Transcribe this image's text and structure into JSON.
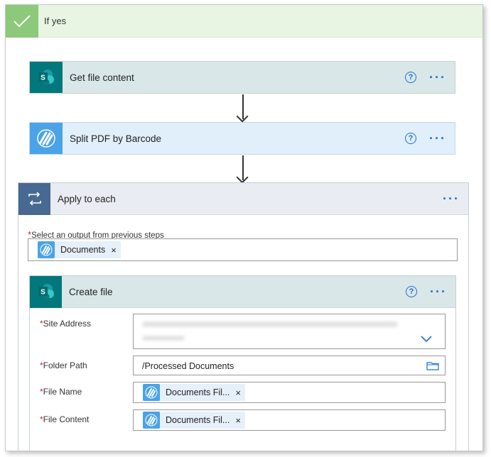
{
  "if_yes": {
    "title": "If yes"
  },
  "steps": {
    "get_file_content": {
      "title": "Get file content"
    },
    "split_pdf": {
      "title": "Split PDF by Barcode"
    }
  },
  "apply_to_each": {
    "title": "Apply to each",
    "output_label": "Select an output from previous steps",
    "output_token": "Documents"
  },
  "create_file": {
    "title": "Create file",
    "site_address_label": "Site Address",
    "folder_path_label": "Folder Path",
    "folder_path_value": "/Processed Documents",
    "file_name_label": "File Name",
    "file_name_token": "Documents Fil...",
    "file_content_label": "File Content",
    "file_content_token": "Documents Fil..."
  },
  "common": {
    "required_mark": "*",
    "help_glyph": "?",
    "more_glyph": "···",
    "close_glyph": "×"
  },
  "colors": {
    "accent": "#1c6fce",
    "sharepoint": "#03787c",
    "pdf": "#4aa3e8",
    "loop": "#486991",
    "condition_yes": "#8cc97a"
  }
}
